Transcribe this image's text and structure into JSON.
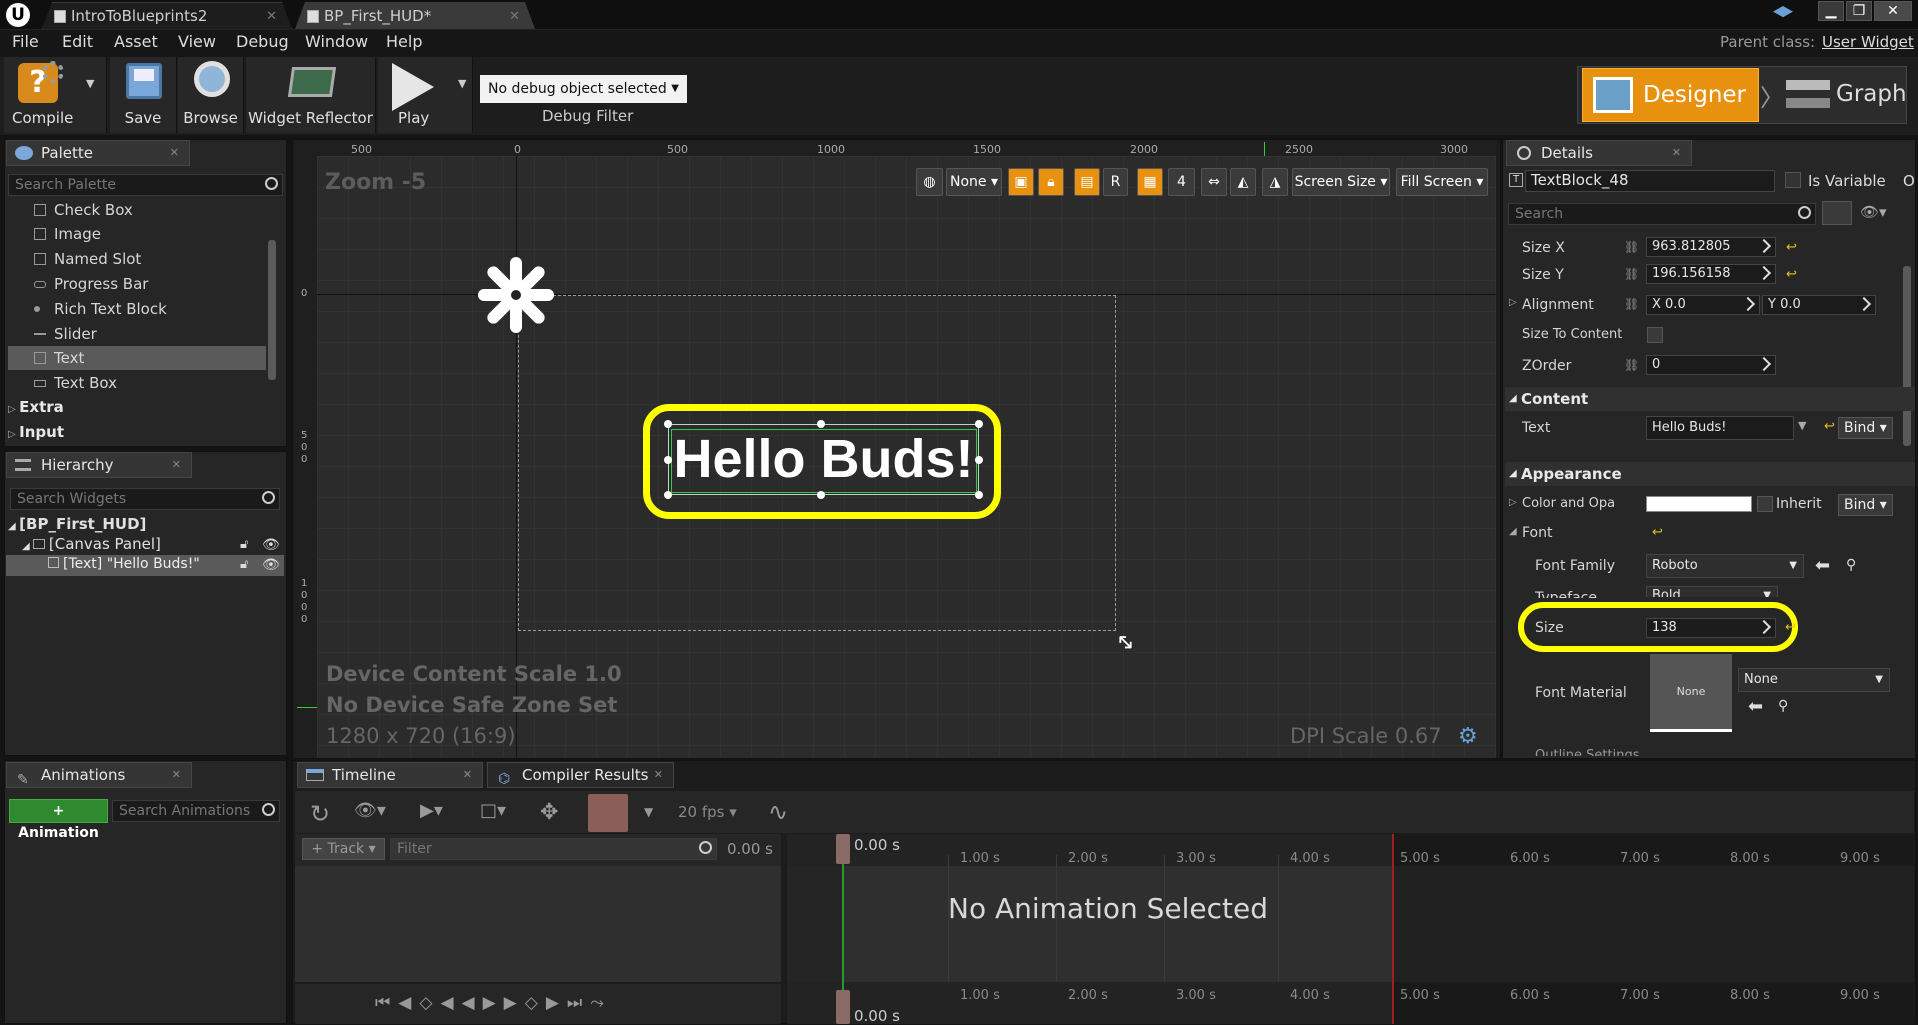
{
  "tabs": [
    {
      "label": "IntroToBlueprints2"
    },
    {
      "label": "BP_First_HUD*"
    }
  ],
  "menu": [
    "File",
    "Edit",
    "Asset",
    "View",
    "Debug",
    "Window",
    "Help"
  ],
  "parent_class": {
    "label": "Parent class:",
    "value": "User Widget"
  },
  "toolbar": {
    "compile": "Compile",
    "save": "Save",
    "browse": "Browse",
    "widget_reflector": "Widget Reflector",
    "play": "Play",
    "debug_select": "No debug object selected",
    "debug_filter": "Debug Filter"
  },
  "modes": {
    "designer": "Designer",
    "graph": "Graph"
  },
  "palette": {
    "tab": "Palette",
    "search_placeholder": "Search Palette",
    "items": [
      "Check Box",
      "Image",
      "Named Slot",
      "Progress Bar",
      "Rich Text Block",
      "Slider",
      "Text",
      "Text Box"
    ],
    "sections": [
      "Extra",
      "Input"
    ]
  },
  "hierarchy": {
    "tab": "Hierarchy",
    "search_placeholder": "Search Widgets",
    "root": "[BP_First_HUD]",
    "canvas": "[Canvas Panel]",
    "text": "[Text] \"Hello Buds!\""
  },
  "animations": {
    "tab": "Animations",
    "add": "+ Animation",
    "search_placeholder": "Search Animations"
  },
  "viewport": {
    "zoom": "Zoom -5",
    "ruler_top": [
      "500",
      "0",
      "500",
      "1000",
      "1500",
      "2000",
      "2500",
      "3000"
    ],
    "ruler_left": [
      "0",
      "5\n0\n0",
      "1\n0\n0\n0"
    ],
    "none": "None",
    "r": "R",
    "grid": "4",
    "screen_size": "Screen Size",
    "fill_screen": "Fill Screen",
    "text": "Hello Buds!",
    "scale": "Device Content Scale 1.0",
    "safe": "No Device Safe Zone Set",
    "res": "1280 x 720 (16:9)",
    "dpi": "DPI Scale 0.67"
  },
  "details": {
    "tab": "Details",
    "name": "TextBlock_48",
    "is_variable": "Is Variable",
    "op": "Op",
    "search_placeholder": "Search",
    "size_x_label": "Size X",
    "size_x": "963.812805",
    "size_y_label": "Size Y",
    "size_y": "196.156158",
    "alignment_label": "Alignment",
    "align_x": "X  0.0",
    "align_y": "Y  0.0",
    "size_to_content": "Size To Content",
    "zorder_label": "ZOrder",
    "zorder": "0",
    "content_head": "Content",
    "text_label": "Text",
    "text_value": "Hello Buds!",
    "bind": "Bind",
    "appearance_head": "Appearance",
    "color_label": "Color and Opa",
    "inherit": "Inherit",
    "font_label": "Font",
    "font_family_label": "Font Family",
    "font_family": "Roboto",
    "typeface_label": "Typeface",
    "typeface": "Bold",
    "size_label": "Size",
    "size": "138",
    "font_material_label": "Font Material",
    "font_material": "None",
    "material_thumb": "None",
    "outline": "Outline Settings"
  },
  "bottom_tabs": {
    "timeline": "Timeline",
    "compiler": "Compiler Results"
  },
  "timeline": {
    "fps": "20 fps",
    "track": "+ Track",
    "filter_placeholder": "Filter",
    "time": "0.00 s",
    "cursor": "0.00 s",
    "ticks": [
      "1.00 s",
      "2.00 s",
      "3.00 s",
      "4.00 s",
      "5.00 s",
      "6.00 s",
      "7.00 s",
      "8.00 s",
      "9.00 s"
    ],
    "no_anim": "No Animation Selected"
  },
  "colors": {
    "accent": "#e8910f",
    "highlight": "#ffff00",
    "selection": "#2ecc40"
  }
}
